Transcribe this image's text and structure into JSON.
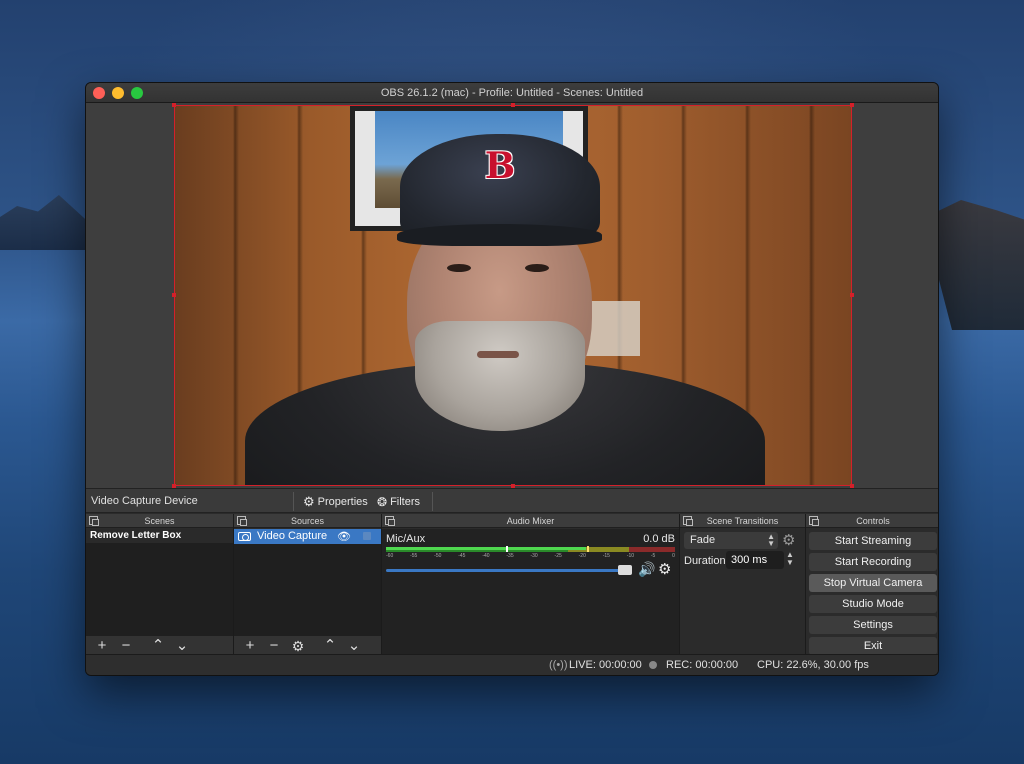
{
  "window": {
    "title": "OBS 26.1.2 (mac) - Profile: Untitled - Scenes: Untitled"
  },
  "source_toolbar": {
    "selected_source": "Video Capture Device",
    "properties_label": "Properties",
    "filters_label": "Filters"
  },
  "scenes": {
    "header": "Scenes",
    "items": [
      "Remove Letter Box"
    ]
  },
  "sources": {
    "header": "Sources",
    "items": [
      "Video Capture"
    ]
  },
  "mixer": {
    "header": "Audio Mixer",
    "channel": "Mic/Aux",
    "db": "0.0 dB",
    "scale": [
      "-60",
      "-55",
      "-50",
      "-45",
      "-40",
      "-35",
      "-30",
      "-25",
      "-20",
      "-15",
      "-10",
      "-5",
      "0"
    ]
  },
  "transitions": {
    "header": "Scene Transitions",
    "selected": "Fade",
    "duration_label": "Duration",
    "duration_value": "300 ms"
  },
  "controls": {
    "header": "Controls",
    "start_streaming": "Start Streaming",
    "start_recording": "Start Recording",
    "stop_virtual_camera": "Stop Virtual Camera",
    "studio_mode": "Studio Mode",
    "settings": "Settings",
    "exit": "Exit"
  },
  "status": {
    "live": "LIVE: 00:00:00",
    "rec": "REC: 00:00:00",
    "cpu": "CPU: 22.6%, 30.00 fps"
  },
  "colors": {
    "accent_selection": "#3a78c4",
    "preview_border": "#d4202a"
  }
}
